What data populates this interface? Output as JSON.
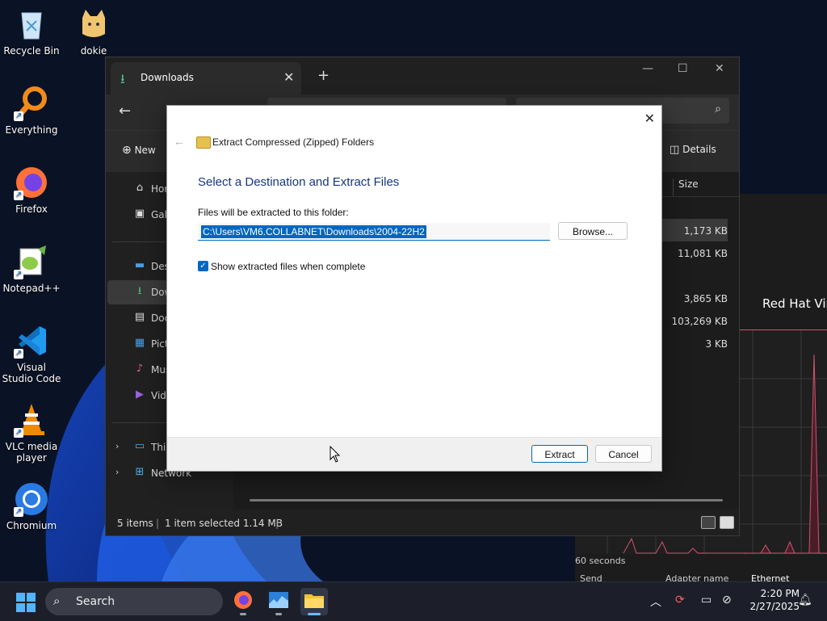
{
  "desktop": {
    "icons": [
      {
        "label": "Recycle Bin"
      },
      {
        "label": "dokie"
      },
      {
        "label": "Everything"
      },
      {
        "label": "Firefox"
      },
      {
        "label": "Notepad++"
      },
      {
        "label": "Visual Studio Code"
      },
      {
        "label": "VLC media player"
      },
      {
        "label": "Chromium"
      }
    ]
  },
  "explorer": {
    "tab_title": "Downloads",
    "new_button": "New",
    "details_button": "Details",
    "column_size": "Size",
    "sidebar": [
      {
        "label": "Home"
      },
      {
        "label": "Gallery"
      },
      {
        "label": "Desktop"
      },
      {
        "label": "Downloads"
      },
      {
        "label": "Documents"
      },
      {
        "label": "Pictures"
      },
      {
        "label": "Music"
      },
      {
        "label": "Videos"
      },
      {
        "label": "This PC"
      },
      {
        "label": "Network"
      }
    ],
    "files": [
      {
        "size": "1,173 KB",
        "selected": true
      },
      {
        "size": "11,081 KB"
      },
      {
        "size": ""
      },
      {
        "size": "3,865 KB"
      },
      {
        "size": "103,269 KB"
      },
      {
        "size": "3 KB"
      }
    ],
    "status": {
      "items": "5 items",
      "selection": "1 item selected  1.14 MB"
    }
  },
  "taskmgr": {
    "title_fragment": "Red Hat Vir",
    "time_span": "60 seconds",
    "cols": [
      "Send",
      "Adapter name",
      "Ethernet"
    ],
    "accent": "#d05370"
  },
  "dialog": {
    "wizard_title": "Extract Compressed (Zipped) Folders",
    "heading": "Select a Destination and Extract Files",
    "path_label": "Files will be extracted to this folder:",
    "path_value": "C:\\Users\\VM6.COLLABNET\\Downloads\\2004-22H2",
    "browse_label": "Browse...",
    "checkbox_label": "Show extracted files when complete",
    "checkbox_checked": true,
    "extract_label": "Extract",
    "cancel_label": "Cancel",
    "accent": "#0067c0"
  },
  "taskbar": {
    "search_label": "Search",
    "time": "2:20 PM",
    "date": "2/27/2025"
  }
}
